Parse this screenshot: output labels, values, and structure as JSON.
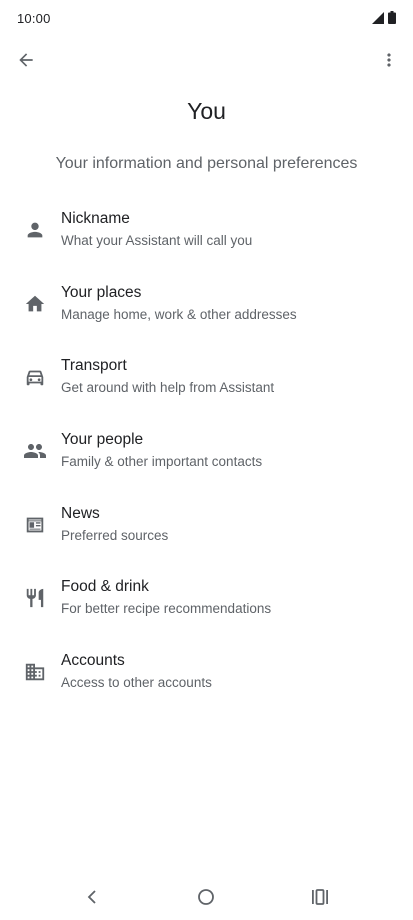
{
  "status_bar": {
    "time": "10:00",
    "icons": [
      "signal-icon",
      "battery-icon"
    ]
  },
  "toolbar": {
    "back_icon": "arrow-back-icon",
    "more_icon": "more-vert-icon"
  },
  "page": {
    "title": "You",
    "subtitle": "Your information and personal preferences"
  },
  "items": [
    {
      "icon": "person-icon",
      "title": "Nickname",
      "subtitle": "What your Assistant will call you"
    },
    {
      "icon": "home-icon",
      "title": "Your places",
      "subtitle": "Manage home, work & other addresses"
    },
    {
      "icon": "car-icon",
      "title": "Transport",
      "subtitle": "Get around with help from Assistant"
    },
    {
      "icon": "people-icon",
      "title": "Your people",
      "subtitle": "Family & other important contacts"
    },
    {
      "icon": "newspaper-icon",
      "title": "News",
      "subtitle": "Preferred sources"
    },
    {
      "icon": "restaurant-icon",
      "title": "Food & drink",
      "subtitle": "For better recipe recommendations"
    },
    {
      "icon": "business-icon",
      "title": "Accounts",
      "subtitle": "Access to other accounts"
    }
  ],
  "nav_bar": {
    "icons": [
      "nav-back-icon",
      "nav-home-icon",
      "nav-recents-icon"
    ]
  },
  "colors": {
    "primary_text": "#202124",
    "secondary_text": "#5f6368",
    "icon": "#5f6368",
    "background": "#ffffff"
  }
}
